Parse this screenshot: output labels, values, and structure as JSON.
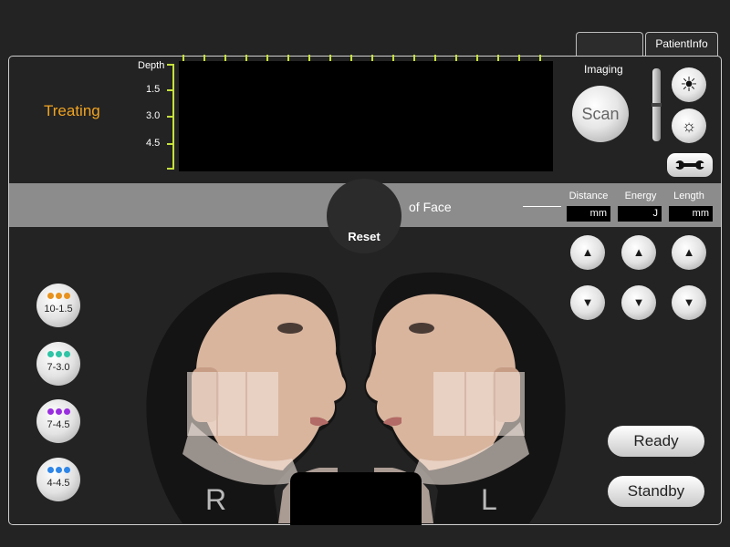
{
  "tabs": {
    "blank": "",
    "patient_info": "PatientInfo"
  },
  "status": {
    "treating": "Treating"
  },
  "depth_scale": {
    "title": "Depth",
    "ticks": [
      "1.5",
      "3.0",
      "4.5"
    ]
  },
  "imaging": {
    "label": "Imaging",
    "scan_label": "Scan"
  },
  "band": {
    "reset_label": "Reset",
    "region_label": "of Face"
  },
  "params": [
    {
      "label": "Distance",
      "unit": "mm"
    },
    {
      "label": "Energy",
      "unit": "J"
    },
    {
      "label": "Length",
      "unit": "mm"
    }
  ],
  "presets": [
    {
      "label": "10-1.5",
      "color": "#e8921e"
    },
    {
      "label": "7-3.0",
      "color": "#2ec4a6"
    },
    {
      "label": "7-4.5",
      "color": "#9a2ee0"
    },
    {
      "label": "4-4.5",
      "color": "#2e86e8"
    }
  ],
  "face_sides": {
    "right": "R",
    "left": "L"
  },
  "actions": {
    "ready": "Ready",
    "standby": "Standby"
  },
  "icons": {
    "brightness_up": "sun-large-icon",
    "brightness_down": "sun-small-icon",
    "settings": "wrench-icon",
    "up": "arrow-up-icon",
    "down": "arrow-down-icon"
  }
}
